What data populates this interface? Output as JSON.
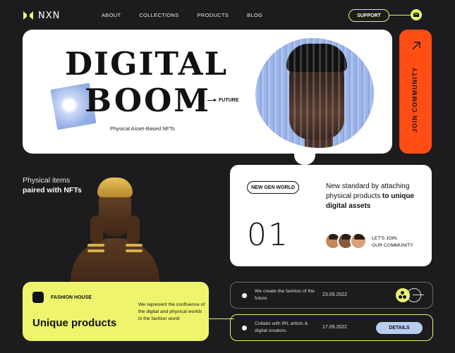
{
  "brand": {
    "name": "NXN"
  },
  "nav": {
    "items": [
      "ABOUT",
      "COLLECTIONS",
      "PRODUCTS",
      "BLOG"
    ]
  },
  "header": {
    "support_label": "SUPPORT",
    "mail_icon": "mail-icon"
  },
  "hero": {
    "title_line1": "DIGITAL",
    "title_line2": "BOOM",
    "future_label": "FUTURE",
    "subtitle": "Physical Asset-Based NFTs"
  },
  "join": {
    "label": "JOIN COMMUNITY",
    "icon": "arrow-up-right-icon",
    "color": "#ff4d14"
  },
  "feature": {
    "line1": "Physical items",
    "line2": "paired with NFTs"
  },
  "genworld": {
    "pill": "NEW GEN WORLD",
    "desc_plain": "New standard by attaching physical products ",
    "desc_bold": "to unique digital assets",
    "number": "01",
    "join_line1": "LET'S JOIN",
    "join_line2": "OUR COMMUNITY"
  },
  "fashion": {
    "label": "FASHION HOUSE",
    "title": "Unique products",
    "description": "We represent the confluence of the digital and physical worlds in the fashion world",
    "color": "#eef56c"
  },
  "rows": [
    {
      "text": "We create the fashion of the future",
      "date": "23.09.2022"
    },
    {
      "text": "Collabs with IRL artists & digital creators.",
      "date": "17.09.2022",
      "button": "DETAILS"
    }
  ],
  "colors": {
    "background": "#1c1c1e",
    "accent_yellow": "#e6f56b",
    "accent_blue": "#b9cdf1"
  }
}
